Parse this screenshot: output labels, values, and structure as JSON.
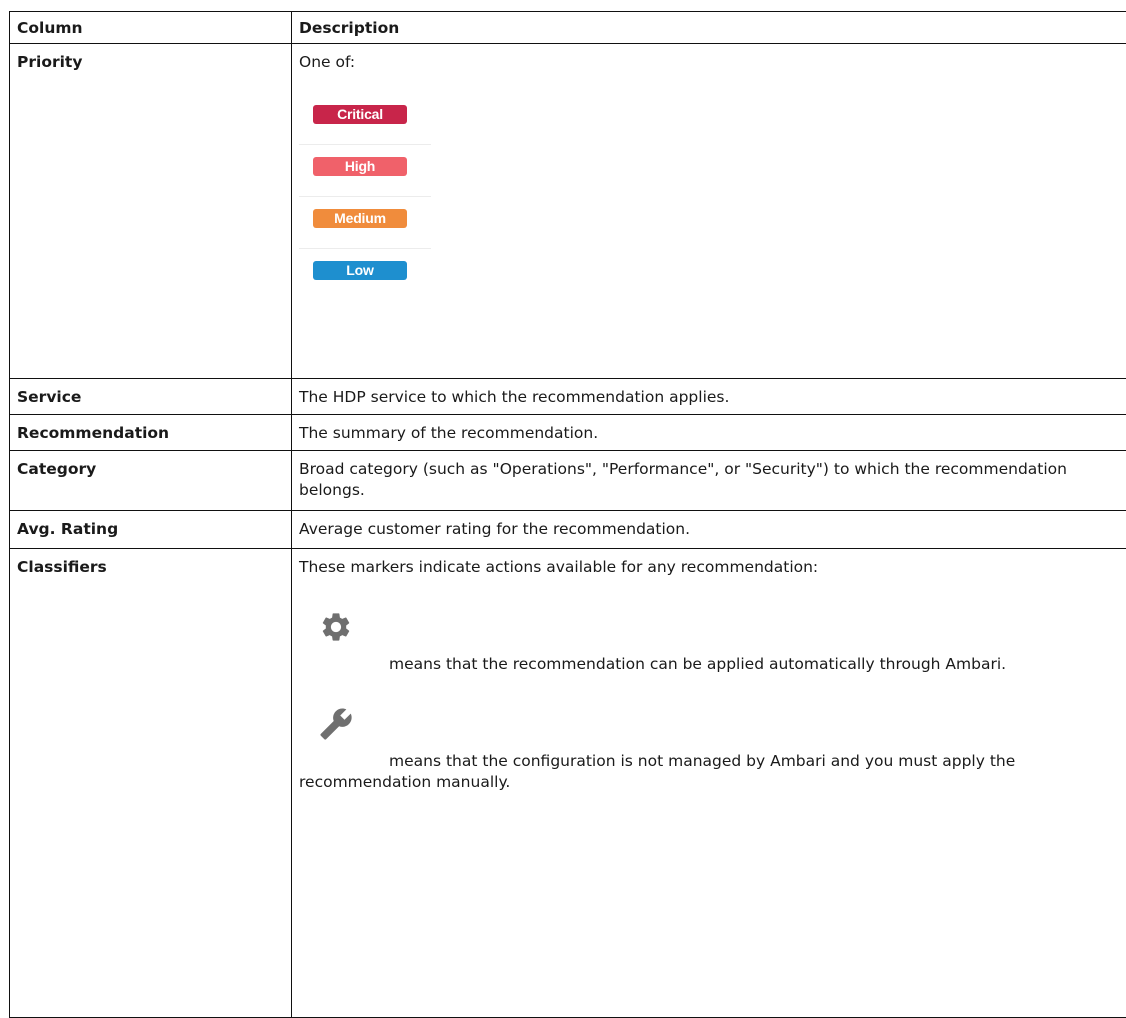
{
  "header": {
    "col1": "Column",
    "col2": "Description"
  },
  "rows": {
    "priority": {
      "label": "Priority",
      "description": "One of:",
      "levels": [
        {
          "label": "Critical",
          "color": "#c8254a"
        },
        {
          "label": "High",
          "color": "#f0616a"
        },
        {
          "label": "Medium",
          "color": "#f08c3c"
        },
        {
          "label": "Low",
          "color": "#1e8fcf"
        }
      ]
    },
    "service": {
      "label": "Service",
      "description": "The HDP service to which the recommendation applies."
    },
    "recommendation": {
      "label": "Recommendation",
      "description": "The summary of the recommendation."
    },
    "category": {
      "label": "Category",
      "description": "Broad category (such as \"Operations\", \"Performance\", or \"Security\") to which the recommendation belongs."
    },
    "rating": {
      "label": "Avg. Rating",
      "description": "Average customer rating for the recommendation."
    },
    "classifiers": {
      "label": "Classifiers",
      "description": "These markers indicate actions available for any recommendation:",
      "markers": [
        {
          "icon": "gear-icon",
          "text": "means that the recommendation can be applied automatically through Ambari."
        },
        {
          "icon": "wrench-icon",
          "text": "means that the configuration is not managed by Ambari and you must apply the recommendation manually."
        }
      ]
    }
  }
}
